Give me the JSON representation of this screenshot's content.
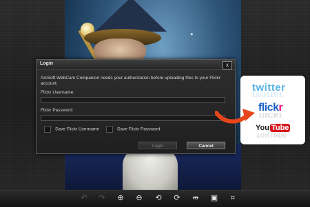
{
  "dialog": {
    "title": "Login",
    "close_symbol": "x",
    "message": "ArcSoft WebCam Companion needs your authorization before uploading files to your Flickr account.",
    "username_label": "Flickr Username:",
    "username_value": "",
    "password_label": "Flickr Password:",
    "password_value": "",
    "save_username_label": "Save Flickr Username",
    "save_password_label": "Save Flickr Password",
    "login_button": "Login",
    "cancel_button": "Cancel"
  },
  "services": {
    "twitter": "twitter",
    "flickr_part1": "flick",
    "flickr_part2": "r",
    "youtube_part1": "You",
    "youtube_part2": "Tube"
  },
  "toolbar": {
    "icons": [
      "undo-icon",
      "redo-icon",
      "zoom-in-icon",
      "zoom-out-icon",
      "rotate-left-icon",
      "rotate-right-icon",
      "flip-horizontal-icon",
      "fit-screen-icon",
      "crop-icon"
    ]
  },
  "colors": {
    "accent_arrow": "#e8461a",
    "twitter_blue": "#5ab3e4",
    "flickr_blue": "#1b62c6",
    "flickr_pink": "#f0087c",
    "youtube_red": "#d5181c"
  }
}
